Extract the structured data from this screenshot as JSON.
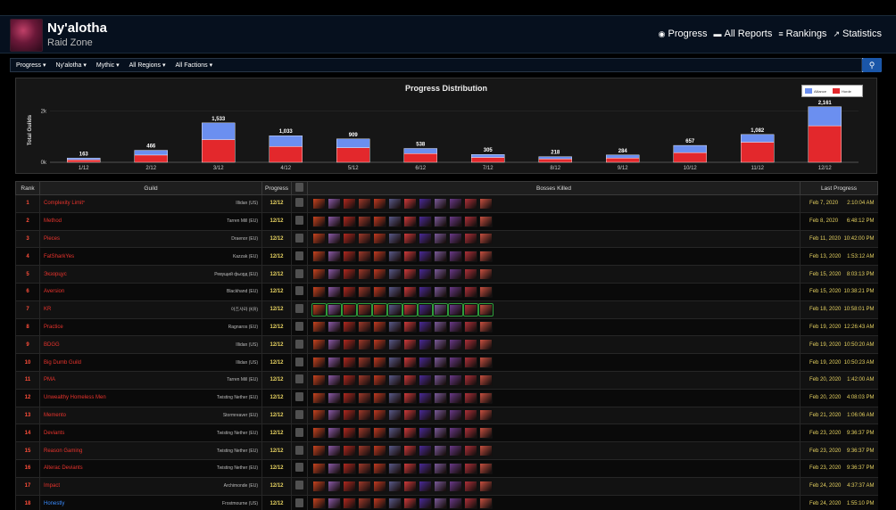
{
  "header": {
    "title": "Ny'alotha",
    "subtitle": "Raid Zone",
    "nav": [
      {
        "label": "Progress",
        "icon": "globe-icon"
      },
      {
        "label": "All Reports",
        "icon": "reports-icon"
      },
      {
        "label": "Rankings",
        "icon": "rankings-icon"
      },
      {
        "label": "Statistics",
        "icon": "statistics-icon"
      }
    ]
  },
  "filters": [
    "Progress ▾",
    "Ny'alotha ▾",
    "Mythic ▾",
    "All Regions ▾",
    "All Factions ▾"
  ],
  "chart_data": {
    "type": "bar",
    "title": "Progress Distribution",
    "ylabel": "Total Guilds",
    "yticks": [
      "2k",
      "0k"
    ],
    "ylim": [
      0,
      2500
    ],
    "categories": [
      "1/12",
      "2/12",
      "3/12",
      "4/12",
      "5/12",
      "6/12",
      "7/12",
      "8/12",
      "9/12",
      "10/12",
      "11/12",
      "12/12"
    ],
    "totals": [
      163,
      466,
      1533,
      1033,
      909,
      538,
      305,
      218,
      284,
      657,
      1082,
      2161
    ],
    "total_labels": [
      "163",
      "466",
      "1,533",
      "1,033",
      "909",
      "538",
      "305",
      "218",
      "284",
      "657",
      "1,082",
      "2,161"
    ],
    "series": [
      {
        "name": "Alliance",
        "color": "#6b8ff0",
        "values": [
          65,
          185,
          650,
          420,
          340,
          200,
          115,
          85,
          120,
          280,
          300,
          740
        ]
      },
      {
        "name": "Horde",
        "color": "#e3282c",
        "values": [
          98,
          281,
          883,
          613,
          569,
          338,
          190,
          133,
          164,
          377,
          782,
          1421
        ]
      }
    ],
    "legend_position": "top-right"
  },
  "table": {
    "headers": {
      "rank": "Rank",
      "guild": "Guild",
      "progress": "Progress",
      "bosses": "Bosses Killed",
      "last": "Last Progress"
    },
    "boss_colors": [
      "#c9431e",
      "#8a5aa8",
      "#b2281e",
      "#a03a2a",
      "#c23a20",
      "#5a5a8a",
      "#d03a3a",
      "#4a2a9a",
      "#7a5a9a",
      "#6a3a8a",
      "#b03038",
      "#c85040"
    ],
    "rows": [
      {
        "rank": "1",
        "guild": "Complexity Limit",
        "star": "*",
        "realm": "Illidan (US)",
        "progress": "12/12",
        "date": "Feb 7, 2020",
        "time": "2:10:04 AM",
        "faction": "horde"
      },
      {
        "rank": "2",
        "guild": "Method",
        "star": "",
        "realm": "Tarren Mill (EU)",
        "progress": "12/12",
        "date": "Feb 8, 2020",
        "time": "6:48:12 PM",
        "faction": "horde"
      },
      {
        "rank": "3",
        "guild": "Pieces",
        "star": "",
        "realm": "Draenor (EU)",
        "progress": "12/12",
        "date": "Feb 11, 2020",
        "time": "10:42:00 PM",
        "faction": "horde"
      },
      {
        "rank": "4",
        "guild": "FatSharkYes",
        "star": "",
        "realm": "Kazzak (EU)",
        "progress": "12/12",
        "date": "Feb 13, 2020",
        "time": "1:53:12 AM",
        "faction": "horde"
      },
      {
        "rank": "5",
        "guild": "Экзорцус",
        "star": "",
        "realm": "Ревущий фьорд (EU)",
        "progress": "12/12",
        "date": "Feb 15, 2020",
        "time": "8:03:13 PM",
        "faction": "horde"
      },
      {
        "rank": "6",
        "guild": "Aversion",
        "star": "",
        "realm": "Blackhand (EU)",
        "progress": "12/12",
        "date": "Feb 15, 2020",
        "time": "10:38:21 PM",
        "faction": "horde"
      },
      {
        "rank": "7",
        "guild": "KR",
        "star": "",
        "realm": "아즈샤라 (KR)",
        "progress": "12/12",
        "date": "Feb 18, 2020",
        "time": "10:58:01 PM",
        "faction": "horde",
        "green": true
      },
      {
        "rank": "8",
        "guild": "Practice",
        "star": "",
        "realm": "Ragnaros (EU)",
        "progress": "12/12",
        "date": "Feb 19, 2020",
        "time": "12:26:43 AM",
        "faction": "horde"
      },
      {
        "rank": "9",
        "guild": "BDGG",
        "star": "",
        "realm": "Illidan (US)",
        "progress": "12/12",
        "date": "Feb 19, 2020",
        "time": "10:50:20 AM",
        "faction": "horde"
      },
      {
        "rank": "10",
        "guild": "Big Dumb Guild",
        "star": "",
        "realm": "Illidan (US)",
        "progress": "12/12",
        "date": "Feb 19, 2020",
        "time": "10:50:23 AM",
        "faction": "horde"
      },
      {
        "rank": "11",
        "guild": "PMA",
        "star": "",
        "realm": "Tarren Mill (EU)",
        "progress": "12/12",
        "date": "Feb 20, 2020",
        "time": "1:42:00 AM",
        "faction": "horde"
      },
      {
        "rank": "12",
        "guild": "Unwealthy Homeless Men",
        "star": "",
        "realm": "Twisting Nether (EU)",
        "progress": "12/12",
        "date": "Feb 20, 2020",
        "time": "4:08:03 PM",
        "faction": "horde"
      },
      {
        "rank": "13",
        "guild": "Memento",
        "star": "",
        "realm": "Stormreaver (EU)",
        "progress": "12/12",
        "date": "Feb 21, 2020",
        "time": "1:06:06 AM",
        "faction": "horde"
      },
      {
        "rank": "14",
        "guild": "Deviants",
        "star": "",
        "realm": "Twisting Nether (EU)",
        "progress": "12/12",
        "date": "Feb 23, 2020",
        "time": "9:36:37 PM",
        "faction": "horde"
      },
      {
        "rank": "15",
        "guild": "Reason Gaming",
        "star": "",
        "realm": "Twisting Nether (EU)",
        "progress": "12/12",
        "date": "Feb 23, 2020",
        "time": "9:36:37 PM",
        "faction": "horde"
      },
      {
        "rank": "16",
        "guild": "Alterac Deviants",
        "star": "",
        "realm": "Twisting Nether (EU)",
        "progress": "12/12",
        "date": "Feb 23, 2020",
        "time": "9:36:37 PM",
        "faction": "horde"
      },
      {
        "rank": "17",
        "guild": "Impact",
        "star": "",
        "realm": "Archimonde (EU)",
        "progress": "12/12",
        "date": "Feb 24, 2020",
        "time": "4:37:37 AM",
        "faction": "horde"
      },
      {
        "rank": "18",
        "guild": "Honestly",
        "star": "",
        "realm": "Frostmourne (US)",
        "progress": "12/12",
        "date": "Feb 24, 2020",
        "time": "1:55:10 PM",
        "faction": "alliance"
      }
    ]
  }
}
